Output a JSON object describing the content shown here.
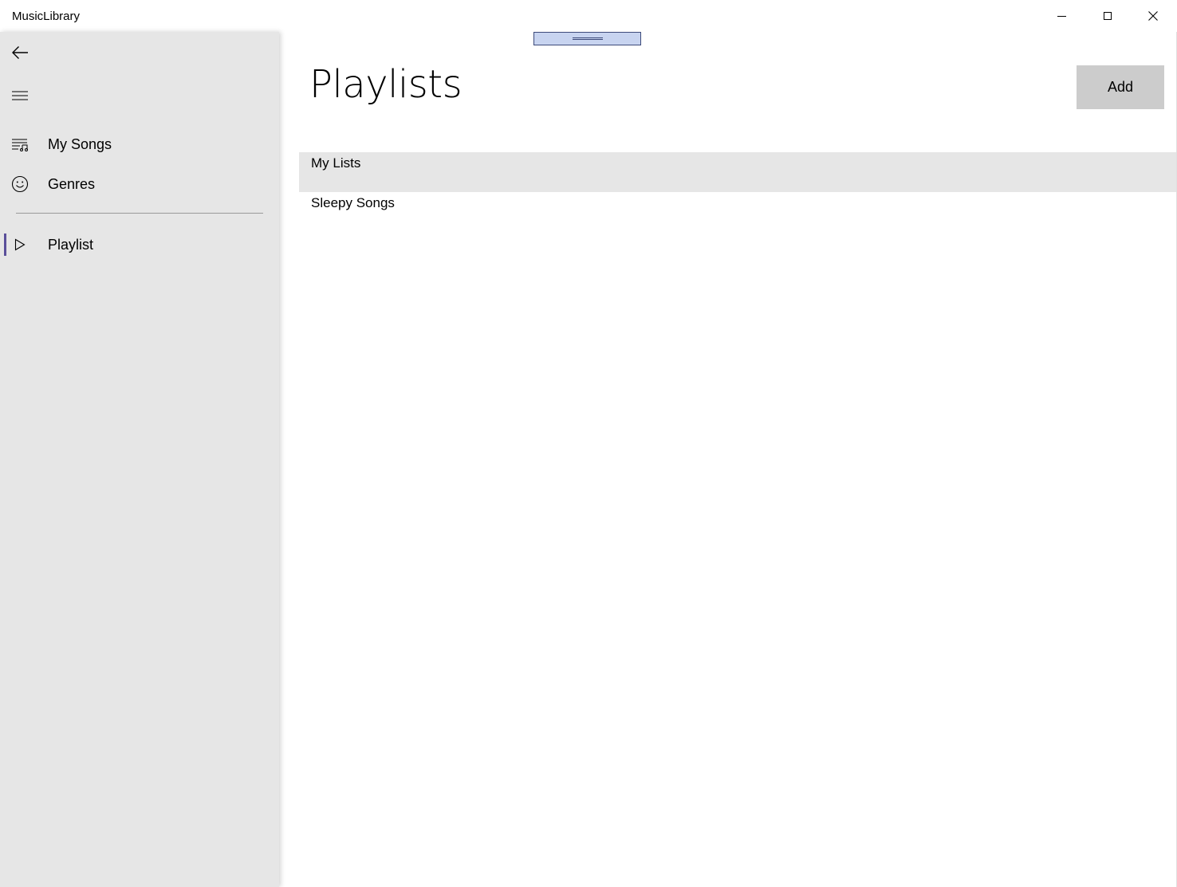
{
  "window": {
    "title": "MusicLibrary",
    "controls": {
      "minimize": "minimize-icon",
      "maximize": "maximize-icon",
      "close": "close-icon"
    }
  },
  "nav": {
    "back_icon": "back-arrow-icon",
    "menu_icon": "hamburger-icon",
    "items": [
      {
        "label": "My Songs",
        "icon": "music-list-icon"
      },
      {
        "label": "Genres",
        "icon": "emoji-icon"
      }
    ],
    "footer_items": [
      {
        "label": "Playlist",
        "icon": "play-icon",
        "selected": true
      }
    ],
    "accent_color": "#5a4f9a",
    "pane_background": "#e6e6e6"
  },
  "main": {
    "title": "Playlists",
    "add_label": "Add",
    "playlists": [
      {
        "label": "My Lists",
        "selected": true
      },
      {
        "label": "Sleepy Songs",
        "selected": false
      }
    ]
  }
}
